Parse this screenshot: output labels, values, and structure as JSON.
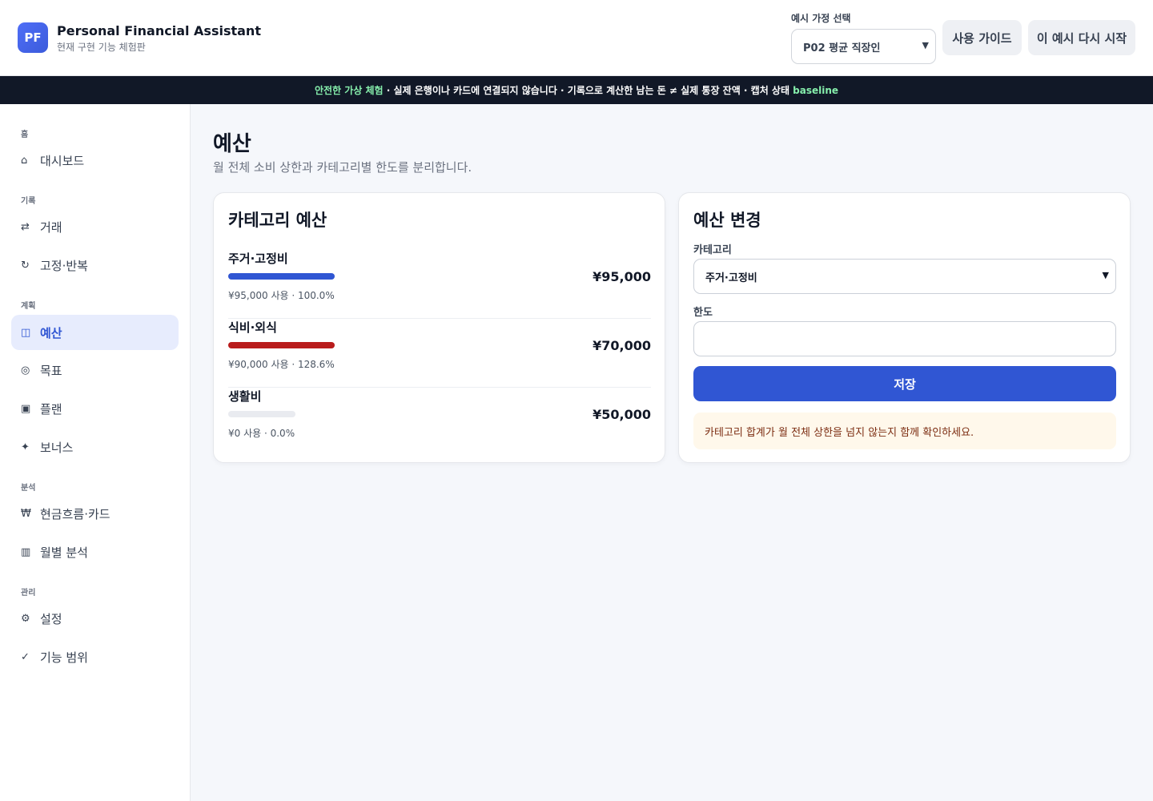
{
  "header": {
    "logo_text": "PF",
    "title": "Personal Financial Assistant",
    "subtitle": "현재 구현 기능 체험판",
    "persona_label": "예시 가정 선택",
    "persona_selected": "P02 평균 직장인",
    "guide_button": "사용 가이드",
    "restart_button": "이 예시 다시 시작"
  },
  "banner": {
    "highlight": "안전한 가상 체험",
    "text": " · 실제 은행이나 카드에 연결되지 않습니다 · 기록으로 계산한 남는 돈 ≠ 실제 통장 잔액 · 캡처 상태 ",
    "state": "baseline"
  },
  "sidebar": {
    "sections": [
      {
        "label": "홈",
        "items": [
          {
            "icon": "⌂",
            "label": "대시보드"
          }
        ]
      },
      {
        "label": "기록",
        "items": [
          {
            "icon": "⇄",
            "label": "거래"
          },
          {
            "icon": "↻",
            "label": "고정·반복"
          }
        ]
      },
      {
        "label": "계획",
        "items": [
          {
            "icon": "◫",
            "label": "예산"
          },
          {
            "icon": "◎",
            "label": "목표"
          },
          {
            "icon": "▣",
            "label": "플랜"
          },
          {
            "icon": "✦",
            "label": "보너스"
          }
        ]
      },
      {
        "label": "분석",
        "items": [
          {
            "icon": "₩",
            "label": "현금흐름·카드"
          },
          {
            "icon": "▥",
            "label": "월별 분석"
          }
        ]
      },
      {
        "label": "관리",
        "items": [
          {
            "icon": "⚙",
            "label": "설정"
          },
          {
            "icon": "✓",
            "label": "기능 범위"
          }
        ]
      }
    ],
    "active": "예산"
  },
  "main": {
    "title": "예산",
    "description": "월 전체 소비 상한과 카테고리별 한도를 분리합니다."
  },
  "budget_card": {
    "title": "카테고리 예산",
    "rows": [
      {
        "name": "주거·고정비",
        "usage_text": "¥95,000 사용 · 100.0%",
        "amount": "¥95,000",
        "used_pct": 100.0,
        "bar_color": "#3056d3"
      },
      {
        "name": "식비·외식",
        "usage_text": "¥90,000 사용 · 128.6%",
        "amount": "¥70,000",
        "used_pct": 128.6,
        "bar_color": "#b91c1c"
      },
      {
        "name": "생활비",
        "usage_text": "¥0 사용 · 0.0%",
        "amount": "¥50,000",
        "used_pct": 0.0,
        "bar_color": "#e9ebf0"
      }
    ]
  },
  "edit_card": {
    "title": "예산 변경",
    "category_label": "카테고리",
    "category_selected": "주거·고정비",
    "limit_label": "한도",
    "limit_value": "",
    "save_button": "저장",
    "notice": "카테고리 합계가 월 전체 상한을 넘지 않는지 함께 확인하세요."
  }
}
